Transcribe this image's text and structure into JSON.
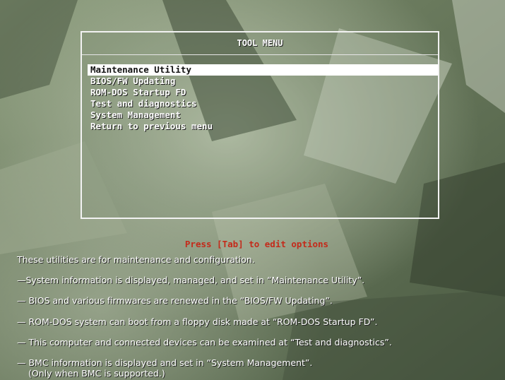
{
  "menu": {
    "title": "TOOL MENU",
    "items": [
      {
        "label": "Maintenance Utility",
        "selected": true
      },
      {
        "label": "BIOS/FW Updating",
        "selected": false
      },
      {
        "label": "ROM-DOS Startup FD",
        "selected": false
      },
      {
        "label": "Test and diagnostics",
        "selected": false
      },
      {
        "label": "System Management",
        "selected": false
      },
      {
        "label": "Return to previous menu",
        "selected": false
      }
    ]
  },
  "hint": "Press [Tab] to edit options",
  "info": {
    "intro": "These utilities are for maintenance and configuration.",
    "lines": [
      "—System information is displayed, managed, and set in “Maintenance Utility”.",
      "— BIOS and various firmwares are renewed in the “BIOS/FW Updating”.",
      "— ROM-DOS system can boot from a floppy disk made at “ROM-DOS Startup FD”.",
      "— This computer and connected devices can be examined at “Test and diagnostics”.",
      "— BMC information is displayed and set in “System Management”."
    ],
    "note": "(Only when BMC is supported.)"
  },
  "colors": {
    "background": "#6a7a5e",
    "menu_border": "#f2f2f2",
    "selected_bg": "#ffffff",
    "hint": "#c42a1a",
    "text": "#ffffff"
  }
}
